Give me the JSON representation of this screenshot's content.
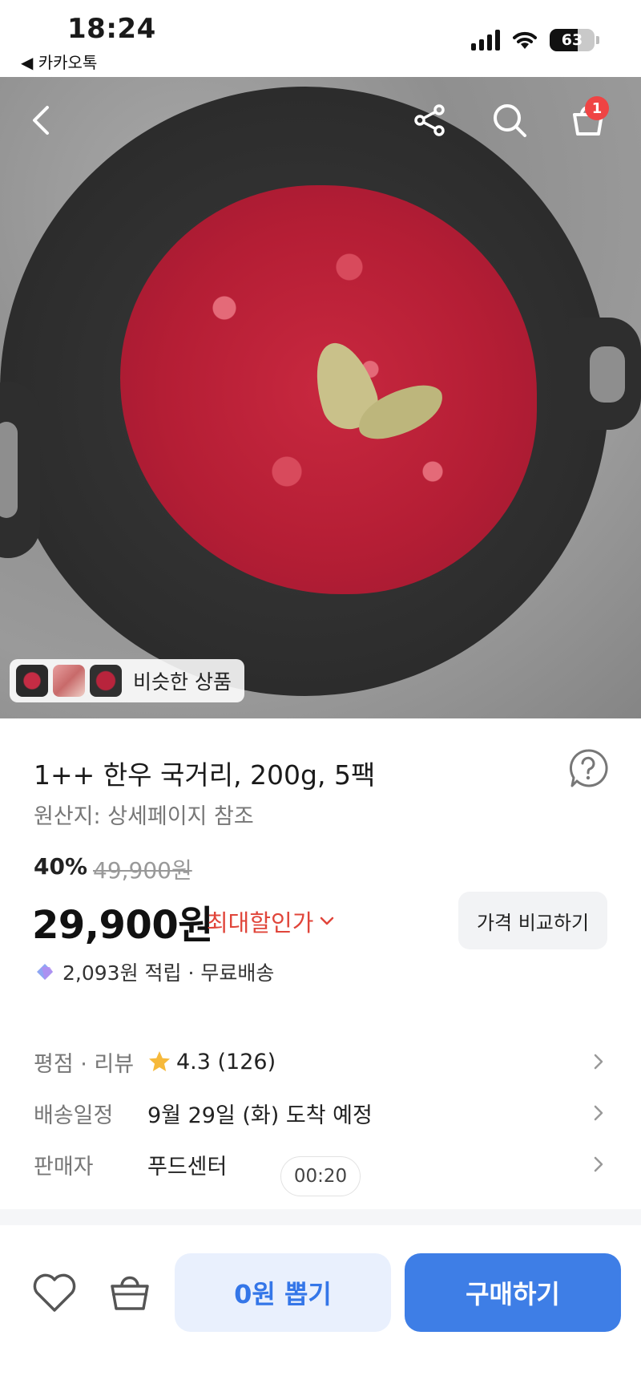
{
  "status_bar": {
    "time": "18:24",
    "back_app": "◀ 카카오톡",
    "battery": "63"
  },
  "header": {
    "back_icon": "chevron-left-icon",
    "share_icon": "share-icon",
    "search_icon": "search-icon",
    "cart_icon": "cart-icon",
    "cart_badge": "1"
  },
  "hero": {
    "similar_label": "비슷한 상품"
  },
  "product": {
    "title": "1++ 한우 국거리, 200g, 5팩",
    "origin": "원산지: 상세페이지 참조",
    "discount_rate": "40%",
    "original_price": "49,900원",
    "price": "29,900원",
    "max_discount_label": "최대할인가",
    "compare_button": "가격 비교하기",
    "points_text": "2,093원 적립 · 무료배송"
  },
  "details": {
    "rating_label": "평점 · 리뷰",
    "rating_value": "4.3 (126)",
    "delivery_label": "배송일정",
    "delivery_value": "9월 29일 (화) 도착 예정",
    "seller_label": "판매자",
    "seller_value": "푸드센터"
  },
  "timer": "00:20",
  "bottom": {
    "draw_button": "0원 뽑기",
    "buy_button": "구매하기"
  },
  "colors": {
    "accent_blue": "#3e7ee6",
    "discount_red": "#e0453a",
    "badge_red": "#ef4444",
    "star": "#f6b93b"
  }
}
